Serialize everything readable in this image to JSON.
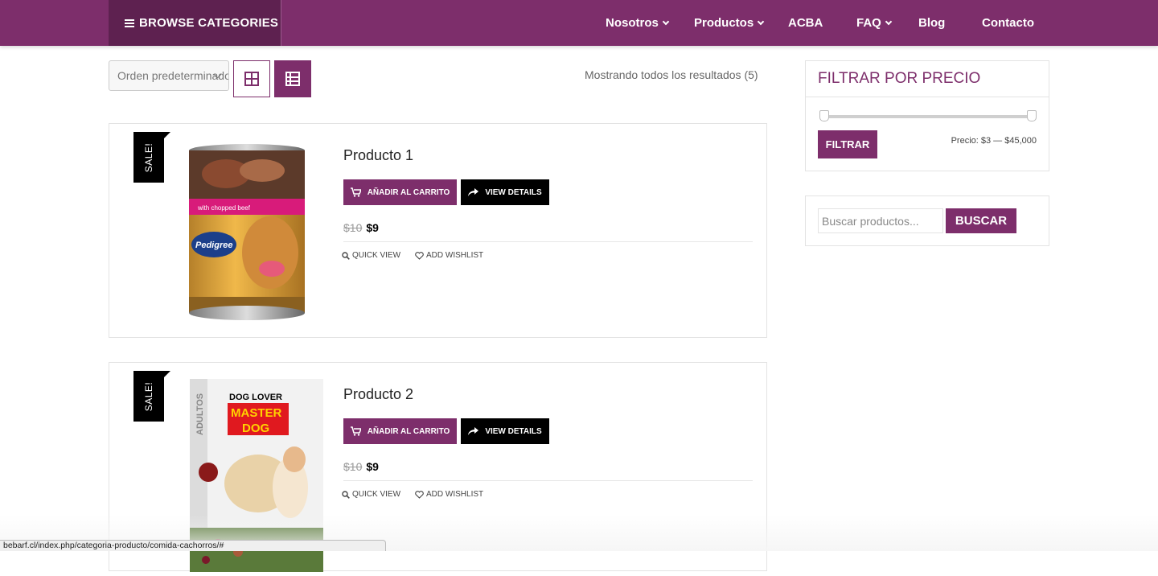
{
  "header": {
    "browse_label": "BROWSE CATEGORIES",
    "nav": [
      {
        "label": "Nosotros",
        "dropdown": true
      },
      {
        "label": "Productos",
        "dropdown": true
      },
      {
        "label": "ACBA",
        "dropdown": false
      },
      {
        "label": "FAQ",
        "dropdown": true
      },
      {
        "label": "Blog",
        "dropdown": false
      },
      {
        "label": "Contacto",
        "dropdown": false
      }
    ]
  },
  "toolbar": {
    "orderby_value": "Orden predeterminado",
    "results_text": "Mostrando todos los resultados (5)",
    "view_modes": [
      "grid-icon",
      "list-icon"
    ]
  },
  "products": [
    {
      "badge": "SALE!",
      "title": "Producto 1",
      "add_to_cart": "Añadir al carrito",
      "view_details": "View details",
      "price_old": "$10",
      "price_new": "$9",
      "quick_view": "Quick view",
      "wishlist": "Add wishlist",
      "image": "dog-food-can"
    },
    {
      "badge": "SALE!",
      "title": "Producto 2",
      "add_to_cart": "Añadir al carrito",
      "view_details": "View details",
      "price_old": "$10",
      "price_new": "$9",
      "quick_view": "Quick view",
      "wishlist": "Add wishlist",
      "image": "dog-food-bag",
      "image_text": {
        "brand": "DOG LOVER",
        "line1": "MASTER",
        "line2": "DOG",
        "side": "ADULTOS"
      }
    }
  ],
  "sidebar": {
    "price_filter": {
      "title": "FILTRAR POR PRECIO",
      "button": "FILTRAR",
      "price_label": "Precio: $3 — $45,000",
      "min": 3,
      "max": 45000
    },
    "search": {
      "placeholder": "Buscar productos...",
      "button": "BUSCAR"
    }
  },
  "status_bar": {
    "url": "bebarf.cl/index.php/categoria-producto/comida-cachorros/#"
  },
  "colors": {
    "brand": "#7d2e6b",
    "brand_dark": "#5e2150",
    "black_button": "#000000"
  }
}
